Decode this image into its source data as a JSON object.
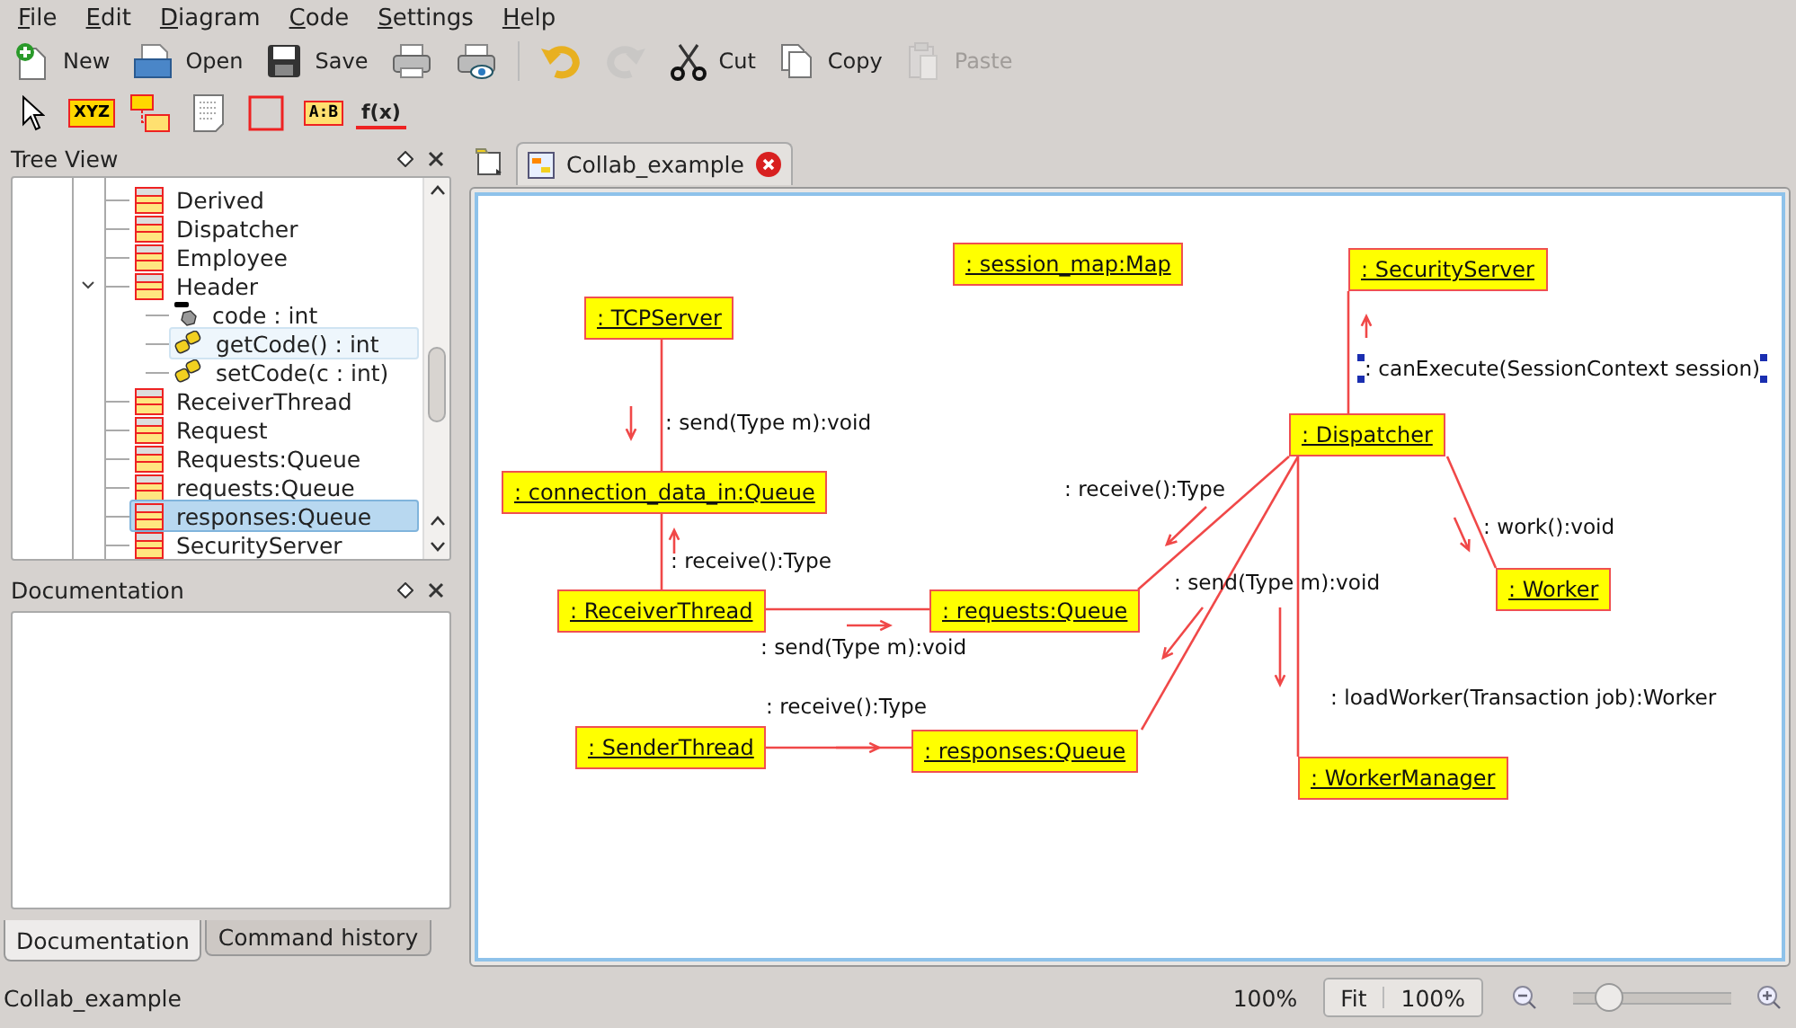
{
  "menu": [
    "File",
    "Edit",
    "Diagram",
    "Code",
    "Settings",
    "Help"
  ],
  "toolbar": [
    {
      "kind": "new",
      "label": "New",
      "disabled": false
    },
    {
      "kind": "open",
      "label": "Open",
      "disabled": false
    },
    {
      "kind": "save",
      "label": "Save",
      "disabled": false
    },
    {
      "kind": "print",
      "disabled": false
    },
    {
      "kind": "preview",
      "disabled": false
    },
    {
      "kind": "undo",
      "disabled": false
    },
    {
      "kind": "redo",
      "disabled": true
    },
    {
      "kind": "cut",
      "label": "Cut",
      "disabled": false
    },
    {
      "kind": "copy",
      "label": "Copy",
      "disabled": false
    },
    {
      "kind": "paste",
      "label": "Paste",
      "disabled": true
    }
  ],
  "palette": [
    {
      "kind": "pointer"
    },
    {
      "kind": "object",
      "label": "XYZ"
    },
    {
      "kind": "multi"
    },
    {
      "kind": "note"
    },
    {
      "kind": "box"
    },
    {
      "kind": "text",
      "label": "A:B"
    },
    {
      "kind": "message",
      "label": "f(x)"
    }
  ],
  "tree_view": {
    "title": "Tree View",
    "items": [
      {
        "kind": "class",
        "label": "Derived",
        "selected": false
      },
      {
        "kind": "class",
        "label": "Dispatcher",
        "selected": false
      },
      {
        "kind": "class",
        "label": "Employee",
        "selected": false
      },
      {
        "kind": "class",
        "label": "Header",
        "selected": false,
        "expanded": true,
        "children": [
          {
            "kind": "attribute",
            "label": "code : int",
            "selected": false
          },
          {
            "kind": "operation",
            "label": "getCode() : int",
            "selected": false,
            "hovered": true
          },
          {
            "kind": "operation",
            "label": "setCode(c : int)",
            "selected": false
          }
        ]
      },
      {
        "kind": "class",
        "label": "ReceiverThread",
        "selected": false
      },
      {
        "kind": "class",
        "label": "Request",
        "selected": false
      },
      {
        "kind": "class",
        "label": "Requests:Queue",
        "selected": false
      },
      {
        "kind": "class",
        "label": "requests:Queue",
        "selected": false
      },
      {
        "kind": "class",
        "label": "responses:Queue",
        "selected": true
      },
      {
        "kind": "class",
        "label": "SecurityServer",
        "selected": false
      }
    ]
  },
  "documentation": {
    "title": "Documentation"
  },
  "dock_tabs": [
    {
      "label": "Documentation",
      "selected": true
    },
    {
      "label": "Command history",
      "selected": false
    }
  ],
  "document_tabs": [
    {
      "label": "Collab_example",
      "selected": true
    }
  ],
  "diagram": {
    "objects": [
      {
        "label": ": session_map:Map"
      },
      {
        "label": ": SecurityServer"
      },
      {
        "label": ": TCPServer"
      },
      {
        "label": ": Dispatcher"
      },
      {
        "label": ": connection_data_in:Queue"
      },
      {
        "label": ": Worker"
      },
      {
        "label": ": ReceiverThread"
      },
      {
        "label": ": requests:Queue"
      },
      {
        "label": ": SenderThread"
      },
      {
        "label": ": responses:Queue"
      },
      {
        "label": ": WorkerManager"
      }
    ],
    "messages": [
      {
        "text": ": canExecute(SessionContext session)",
        "selected": true
      },
      {
        "text": ": send(Type m):void",
        "selected": false
      },
      {
        "text": ": receive():Type",
        "selected": false
      },
      {
        "text": ": work():void",
        "selected": false
      },
      {
        "text": ": receive():Type",
        "selected": false
      },
      {
        "text": ": send(Type m):void",
        "selected": false
      },
      {
        "text": ": send(Type m):void",
        "selected": false
      },
      {
        "text": ": loadWorker(Transaction job):Worker",
        "selected": false
      },
      {
        "text": ": receive():Type",
        "selected": false
      }
    ]
  },
  "status_bar": {
    "text": "Collab_example",
    "zoom": "100%",
    "buttons": [
      "Fit",
      "100%"
    ],
    "zoom_slider": {
      "level": 0.17
    }
  }
}
